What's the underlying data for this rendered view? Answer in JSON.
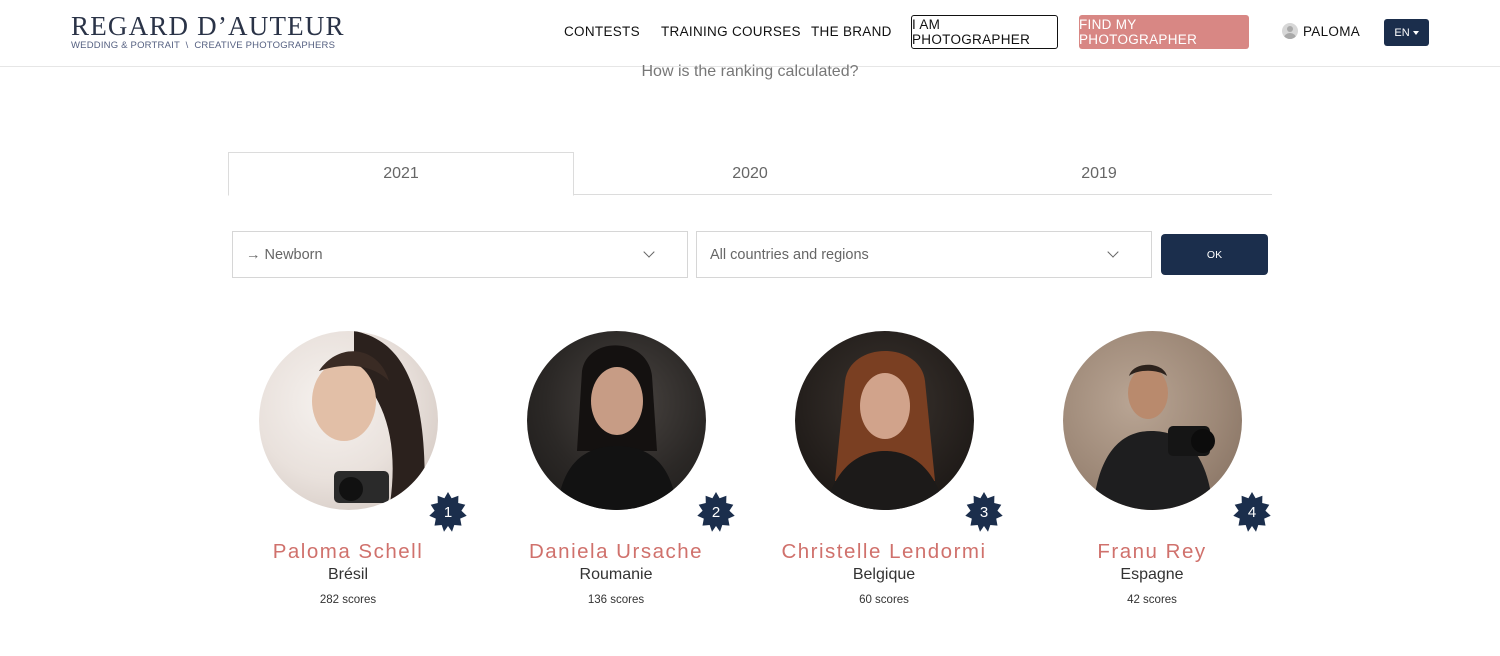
{
  "header": {
    "logo_main": "REGARD D’AUTEUR",
    "logo_sub_left": "WEDDING & PORTRAIT",
    "logo_sub_sep": "\\",
    "logo_sub_right": "CREATIVE PHOTOGRAPHERS",
    "nav": {
      "contests": "CONTESTS",
      "training": "TRAINING COURSES",
      "brand": "THE BRAND"
    },
    "i_am_photographer": "I AM PHOTOGRAPHER",
    "find_photographer": "FIND MY PHOTOGRAPHER",
    "user_name": "PALOMA",
    "language": "EN"
  },
  "ranking_link": "How is the ranking calculated?",
  "tabs": [
    "2021",
    "2020",
    "2019"
  ],
  "active_tab": "2021",
  "filters": {
    "category": "→ Newborn",
    "region": "All countries and regions",
    "ok_label": "OK"
  },
  "colors": {
    "navy": "#1b2e4c",
    "rose": "#d88784",
    "name_rose": "#d0716c"
  },
  "photographers": [
    {
      "rank": "1",
      "name": "Paloma Schell",
      "country": "Brésil",
      "scores": "282 scores"
    },
    {
      "rank": "2",
      "name": "Daniela Ursache",
      "country": "Roumanie",
      "scores": "136 scores"
    },
    {
      "rank": "3",
      "name": "Christelle Lendormi",
      "country": "Belgique",
      "scores": "60 scores"
    },
    {
      "rank": "4",
      "name": "Franu Rey",
      "country": "Espagne",
      "scores": "42 scores"
    }
  ]
}
